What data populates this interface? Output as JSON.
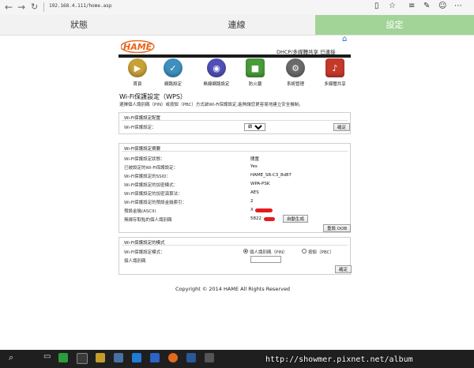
{
  "browser": {
    "url": "192.168.4.111/home.asp"
  },
  "tabs": [
    {
      "label": "狀態"
    },
    {
      "label": "連線"
    },
    {
      "label": "設定"
    }
  ],
  "header": {
    "logo_text": "HAME",
    "status": "DHCP/多媒體共享   已連接"
  },
  "nav_items": [
    {
      "label": "首頁",
      "color": "#c8a137",
      "icon": "play-icon"
    },
    {
      "label": "網路設定",
      "color": "#3f8fbf",
      "icon": "globe-check-icon"
    },
    {
      "label": "無線網路設定",
      "color": "#5050b8",
      "icon": "wifi-icon"
    },
    {
      "label": "防火牆",
      "color": "#4a9b3a",
      "icon": "shield-icon"
    },
    {
      "label": "系統管理",
      "color": "#6a6a6a",
      "icon": "gear-icon"
    },
    {
      "label": "多媒體共享",
      "color": "#c43a2a",
      "icon": "media-icon"
    }
  ],
  "page": {
    "title": "Wi-Fi保護設定（WPS）",
    "description": "選擇個人識別碼（PIN）或按鈕（PBC）方式啟Wi-Fi保護設定,能夠讓您更容易地建立安全機制。"
  },
  "config": {
    "heading": "Wi-Fi保護設定配置",
    "label": "Wi-Fi保護設定：",
    "select_value": "啟用",
    "confirm": "確定"
  },
  "summary": {
    "heading": "Wi-Fi保護設定摘要",
    "rows": [
      {
        "label": "Wi-Fi保護設定狀態：",
        "value": "閒置"
      },
      {
        "label": "已被設定的Wi-Fi保護設定：",
        "value": "Yes"
      },
      {
        "label": "Wi-Fi保護設定的SSID：",
        "value": "HAME_SR-C3_8d87"
      },
      {
        "label": "Wi-Fi保護設定的加密模式：",
        "value": "WPA-PSK"
      },
      {
        "label": "Wi-Fi保護設定的加密演算法：",
        "value": "AES"
      },
      {
        "label": "Wi-Fi保護設定的預設金鑰索引：",
        "value": "2"
      },
      {
        "label": "預設金鑰(ASCII)",
        "value": "X"
      },
      {
        "label": "無線存取點的個人識別碼",
        "value": "5822"
      }
    ],
    "auto_generate": "自動生成",
    "reset_oob": "重設 OOB"
  },
  "mode": {
    "heading": "Wi-Fi保護設定的模式",
    "mode_label": "Wi-Fi保護設定模式：",
    "option_pin": "個人識別碼（PIN）",
    "option_pbc": "按鈕（PBC）",
    "pin_label": "個人識別碼",
    "confirm": "確定"
  },
  "footer": {
    "copyright": "Copyright © 2014 HAME All Rights Reserved"
  },
  "watermark": "http://showmer.pixnet.net/album",
  "colors": {
    "active_tab": "#a2d497",
    "redaction": "#e21d1d",
    "taskbar": "#1f1f1f"
  }
}
